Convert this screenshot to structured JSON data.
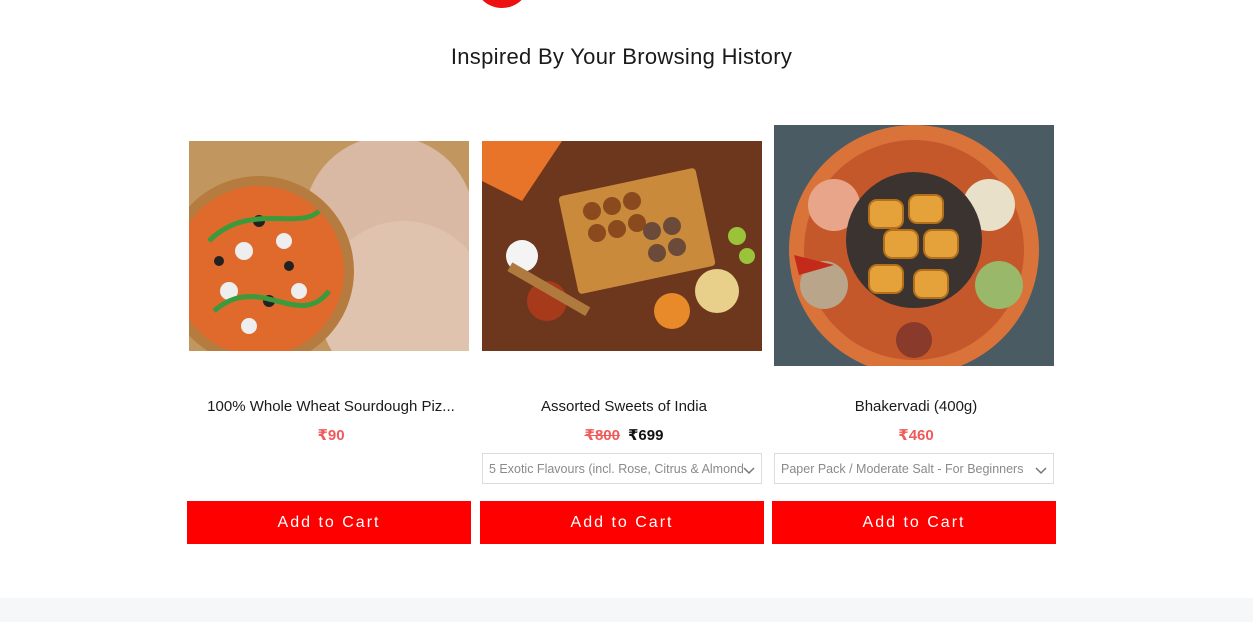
{
  "section": {
    "title": "Inspired By Your Browsing History"
  },
  "products": [
    {
      "name": "100% Whole Wheat Sourdough Piz...",
      "price": "₹90",
      "image_icon": "pizza-base-photo",
      "button": "Add to Cart"
    },
    {
      "name": "Assorted Sweets of India",
      "old_price": "₹800",
      "price": "₹699",
      "variant": "5 Exotic Flavours (incl. Rose, Citrus & Almond",
      "image_icon": "sweets-box-photo",
      "button": "Add to Cart"
    },
    {
      "name": "Bhakervadi (400g)",
      "price": "₹460",
      "variant": "Paper Pack / Moderate Salt - For Beginners",
      "image_icon": "bhakervadi-bowl-photo",
      "button": "Add to Cart"
    }
  ],
  "colors": {
    "accent": "#ff0000",
    "price_red": "#f05a5a",
    "footer_bg": "#f6f7f9"
  }
}
